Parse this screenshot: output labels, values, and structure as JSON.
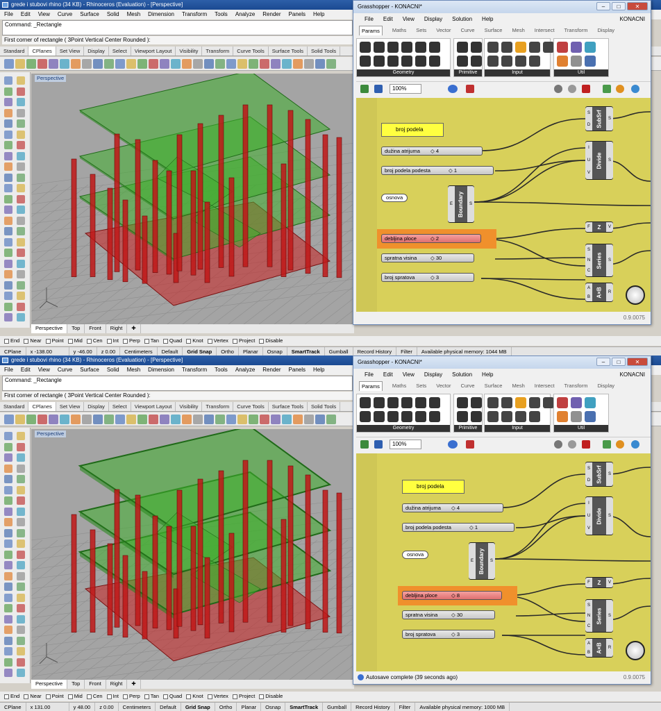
{
  "colors": {
    "rhino_title": "#1b4a92",
    "gh_canvas": "#d8d05a",
    "column": "#c01818",
    "slab": "#3a9a2a",
    "viewport_bg": "#a4a4a4",
    "orange_highlight": "#f0902c"
  },
  "screens": [
    {
      "rhino": {
        "title": "grede i stubovi rhino (34 KB) - Rhinoceros (Evaluation) - [Perspective]",
        "menu": [
          "File",
          "Edit",
          "View",
          "Curve",
          "Surface",
          "Solid",
          "Mesh",
          "Dimension",
          "Transform",
          "Tools",
          "Analyze",
          "Render",
          "Panels",
          "Help"
        ],
        "command": "Command: _Rectangle",
        "prompt": "First corner of rectangle ( 3Point  Vertical  Center  Rounded ):",
        "tabs": [
          "Standard",
          "CPlanes",
          "Set View",
          "Display",
          "Select",
          "Viewport Layout",
          "Visibility",
          "Transform",
          "Curve Tools",
          "Surface Tools",
          "Solid Tools"
        ],
        "viewport_label": "Perspective",
        "viewport_tabs": [
          "Perspective",
          "Top",
          "Front",
          "Right"
        ],
        "osnaps": [
          "End",
          "Near",
          "Point",
          "Mid",
          "Cen",
          "Int",
          "Perp",
          "Tan",
          "Quad",
          "Knot",
          "Vertex",
          "Project",
          "Disable"
        ],
        "status": {
          "cplane": "CPlane",
          "x": "x -138.00",
          "y": "y -46.00",
          "z": "z 0.00",
          "units": "Centimeters",
          "layer": "Default",
          "grid": "Grid Snap",
          "ortho": "Ortho",
          "planar": "Planar",
          "osnap": "Osnap",
          "smarttrack": "SmartTrack",
          "gumball": "Gumball",
          "history": "Record History",
          "filter": "Filter",
          "memory": "Available physical memory: 1044 MB"
        }
      },
      "gh": {
        "title": "Grasshopper - KONACNI*",
        "menu": [
          "File",
          "Edit",
          "View",
          "Display",
          "Solution",
          "Help"
        ],
        "doc": "KONACNI",
        "tabs": [
          "Params",
          "Maths",
          "Sets",
          "Vector",
          "Curve",
          "Surface",
          "Mesh",
          "Intersect",
          "Transform",
          "Display"
        ],
        "groups": [
          "Geometry",
          "Primitive",
          "Input",
          "Util"
        ],
        "zoom": "100%",
        "panel": "broj podela",
        "sliders": [
          {
            "label": "dužina atrijuma",
            "value": "4"
          },
          {
            "label": "broj podela podesta",
            "value": "1"
          },
          {
            "label": "debljina ploce",
            "value": "2"
          },
          {
            "label": "spratna visina",
            "value": "30"
          },
          {
            "label": "broj spratova",
            "value": "3"
          }
        ],
        "param": "osnova",
        "components": [
          {
            "name": "SubSrf",
            "inputs": [
              "S",
              "D"
            ],
            "outputs": [
              "S"
            ]
          },
          {
            "name": "Divide",
            "inputs": [
              "I",
              "U",
              "V"
            ],
            "outputs": [
              "S"
            ]
          },
          {
            "name": "Boundary",
            "inputs": [
              "E"
            ],
            "outputs": [
              "S"
            ]
          },
          {
            "name": "Z",
            "inputs": [
              "F"
            ],
            "outputs": [
              "V"
            ]
          },
          {
            "name": "Series",
            "inputs": [
              "S",
              "N",
              "C"
            ],
            "outputs": [
              "S"
            ]
          },
          {
            "name": "A×B",
            "inputs": [
              "A",
              "B"
            ],
            "outputs": [
              "R"
            ]
          }
        ],
        "footer_msg": "",
        "version": "0.9.0075"
      }
    },
    {
      "rhino": {
        "title": "grede i stubovi rhino (34 KB) - Rhinoceros (Evaluation) - [Perspective]",
        "menu": [
          "File",
          "Edit",
          "View",
          "Curve",
          "Surface",
          "Solid",
          "Mesh",
          "Dimension",
          "Transform",
          "Tools",
          "Analyze",
          "Render",
          "Panels",
          "Help"
        ],
        "command": "Command: _Rectangle",
        "prompt": "First corner of rectangle ( 3Point  Vertical  Center  Rounded ):",
        "tabs": [
          "Standard",
          "CPlanes",
          "Set View",
          "Display",
          "Select",
          "Viewport Layout",
          "Visibility",
          "Transform",
          "Curve Tools",
          "Surface Tools",
          "Solid Tools"
        ],
        "viewport_label": "Perspective",
        "viewport_tabs": [
          "Perspective",
          "Top",
          "Front",
          "Right"
        ],
        "osnaps": [
          "End",
          "Near",
          "Point",
          "Mid",
          "Cen",
          "Int",
          "Perp",
          "Tan",
          "Quad",
          "Knot",
          "Vertex",
          "Project",
          "Disable"
        ],
        "status": {
          "cplane": "CPlane",
          "x": "x 131.00",
          "y": "y 48.00",
          "z": "z 0.00",
          "units": "Centimeters",
          "layer": "Default",
          "grid": "Grid Snap",
          "ortho": "Ortho",
          "planar": "Planar",
          "osnap": "Osnap",
          "smarttrack": "SmartTrack",
          "gumball": "Gumball",
          "history": "Record History",
          "filter": "Filter",
          "memory": "Available physical memory: 1000 MB"
        }
      },
      "gh": {
        "title": "Grasshopper - KONACNI*",
        "menu": [
          "File",
          "Edit",
          "View",
          "Display",
          "Solution",
          "Help"
        ],
        "doc": "KONACNI",
        "tabs": [
          "Params",
          "Maths",
          "Sets",
          "Vector",
          "Curve",
          "Surface",
          "Mesh",
          "Intersect",
          "Transform",
          "Display"
        ],
        "groups": [
          "Geometry",
          "Primitive",
          "Input",
          "Util"
        ],
        "zoom": "100%",
        "panel": "broj podela",
        "sliders": [
          {
            "label": "dužina atrijuma",
            "value": "4"
          },
          {
            "label": "broj podela podesta",
            "value": "1"
          },
          {
            "label": "debljina ploce",
            "value": "8"
          },
          {
            "label": "spratna visina",
            "value": "30"
          },
          {
            "label": "broj spratova",
            "value": "3"
          }
        ],
        "param": "osnova",
        "components": [
          {
            "name": "SubSrf",
            "inputs": [
              "S",
              "D"
            ],
            "outputs": [
              "S"
            ]
          },
          {
            "name": "Divide",
            "inputs": [
              "I",
              "U",
              "V"
            ],
            "outputs": [
              "S"
            ]
          },
          {
            "name": "Boundary",
            "inputs": [
              "E"
            ],
            "outputs": [
              "S"
            ]
          },
          {
            "name": "Z",
            "inputs": [
              "F"
            ],
            "outputs": [
              "V"
            ]
          },
          {
            "name": "Series",
            "inputs": [
              "S",
              "N",
              "C"
            ],
            "outputs": [
              "S"
            ]
          },
          {
            "name": "A×B",
            "inputs": [
              "A",
              "B"
            ],
            "outputs": [
              "R"
            ]
          }
        ],
        "footer_msg": "Autosave complete (39 seconds ago)",
        "version": "0.9.0075"
      }
    }
  ]
}
